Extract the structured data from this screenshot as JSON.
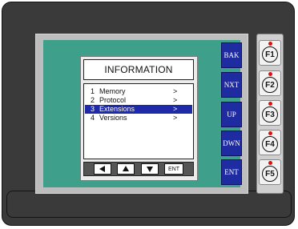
{
  "dialog": {
    "title": "INFORMATION",
    "items": [
      {
        "number": "1",
        "label": "Memory",
        "arrow": ">",
        "selected": false
      },
      {
        "number": "2",
        "label": "Protocol",
        "arrow": ">",
        "selected": false
      },
      {
        "number": "3",
        "label": "Extensions",
        "arrow": ">",
        "selected": true
      },
      {
        "number": "4",
        "label": "Versions",
        "arrow": ">",
        "selected": false
      }
    ]
  },
  "nav_buttons": {
    "left_icon": "left-arrow-icon",
    "up_icon": "up-arrow-icon",
    "down_icon": "down-arrow-icon",
    "enter_label": "ENT"
  },
  "side_buttons": [
    "BAK",
    "NXT",
    "UP",
    "DWN",
    "ENT"
  ],
  "function_keys": [
    "F1",
    "F2",
    "F3",
    "F4",
    "F5"
  ],
  "colors": {
    "bezel": "#3a3a3a",
    "lcd_background": "#3ea08a",
    "side_button": "#1f2ba0",
    "selection": "#1e2aa8",
    "key_indicator": "#dd1111"
  }
}
